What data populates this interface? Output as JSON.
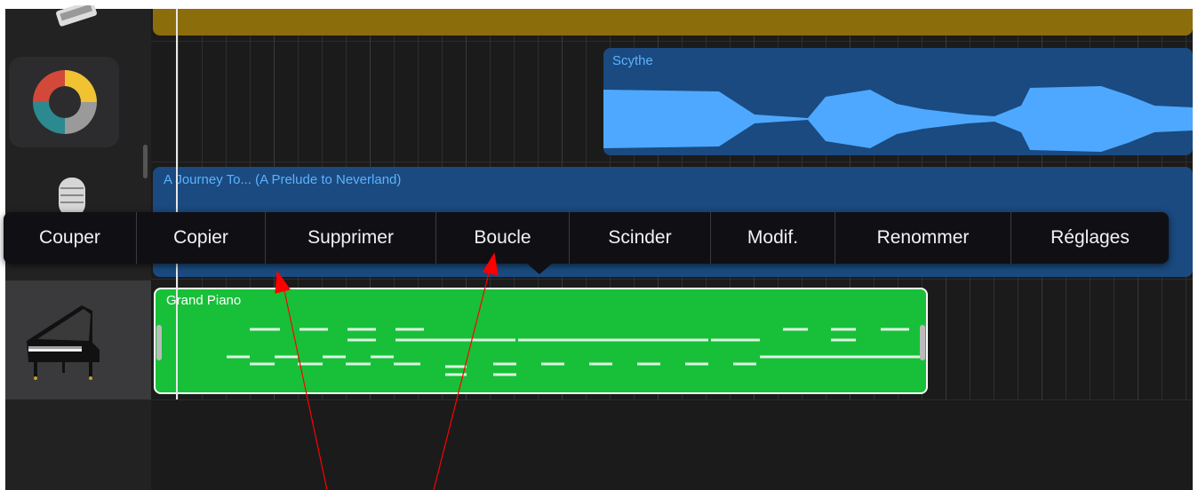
{
  "colors": {
    "background": "#1b1b1b",
    "track_header_bg": "#222222",
    "top_region": "#8c6d0c",
    "audio_region": "#1a4a80",
    "audio_waveform": "#4ea8ff",
    "piano_region": "#17c038",
    "menu_bg": "#101014",
    "annotation_arrow": "#ff0000"
  },
  "tracks": [
    {
      "icon": "drummer-icon"
    },
    {
      "icon": "sampler-wheel-icon"
    },
    {
      "icon": "microphone-icon"
    },
    {
      "icon": "grand-piano-icon"
    }
  ],
  "regions": {
    "scythe": {
      "title": "Scythe"
    },
    "journey": {
      "title": "A Journey To... (A Prelude to Neverland)"
    },
    "grand_piano": {
      "title": "Grand Piano"
    }
  },
  "context_menu": {
    "items": [
      "Couper",
      "Copier",
      "Supprimer",
      "Boucle",
      "Scinder",
      "Modif.",
      "Renommer",
      "Réglages"
    ]
  }
}
